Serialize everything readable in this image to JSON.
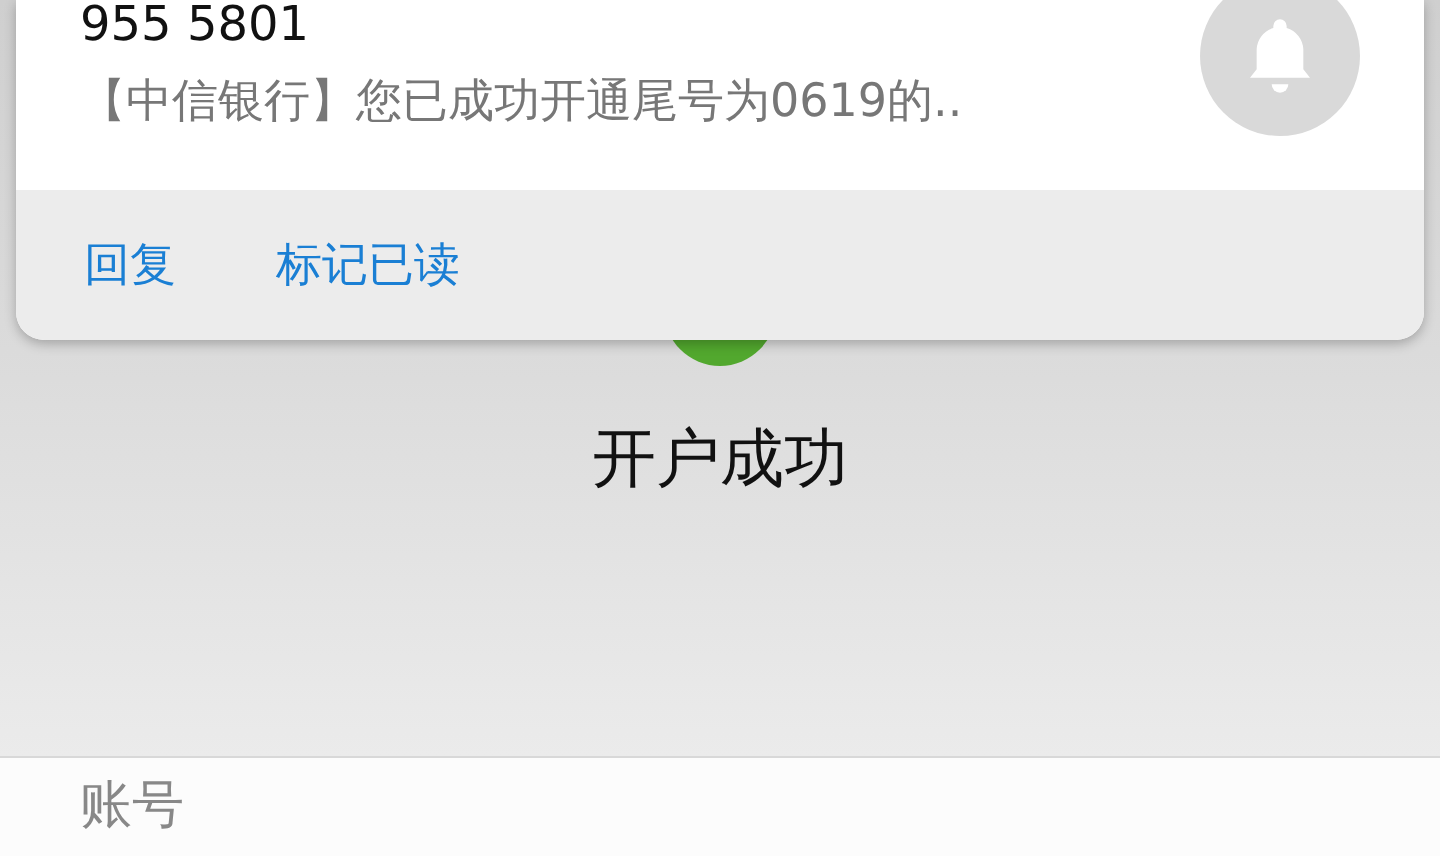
{
  "notification": {
    "sender": "955 5801",
    "message": "【中信银行】您已成功开通尾号为0619的..",
    "actions": [
      "回复",
      "标记已读"
    ]
  },
  "page": {
    "status": "开户成功",
    "fields": [
      {
        "label": "账号"
      }
    ]
  }
}
